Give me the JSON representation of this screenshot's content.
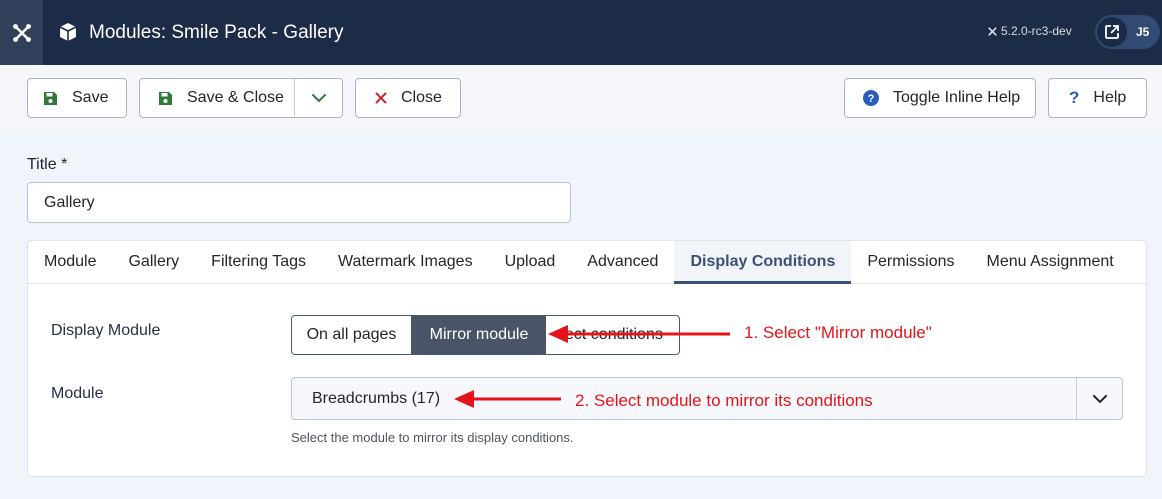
{
  "header": {
    "title": "Modules: Smile Pack - Gallery",
    "version": "5.2.0-rc3-dev",
    "user_badge": "J5"
  },
  "toolbar": {
    "save_label": "Save",
    "save_close_label": "Save & Close",
    "close_label": "Close",
    "toggle_help_label": "Toggle Inline Help",
    "help_label": "Help"
  },
  "form": {
    "title_label": "Title *",
    "title_value": "Gallery"
  },
  "tabs": [
    {
      "label": "Module"
    },
    {
      "label": "Gallery"
    },
    {
      "label": "Filtering Tags"
    },
    {
      "label": "Watermark Images"
    },
    {
      "label": "Upload"
    },
    {
      "label": "Advanced"
    },
    {
      "label": "Display Conditions",
      "active": true
    },
    {
      "label": "Permissions"
    },
    {
      "label": "Menu Assignment"
    }
  ],
  "display_conditions": {
    "display_module_label": "Display Module",
    "options": [
      "On all pages",
      "Mirror module",
      "ect conditions"
    ],
    "selected_option": "Mirror module",
    "module_label": "Module",
    "module_value": "Breadcrumbs (17)",
    "module_hint": "Select the module to mirror its display conditions."
  },
  "annotations": {
    "step1": "1. Select \"Mirror module\"",
    "step2": "2. Select module to mirror its conditions"
  },
  "colors": {
    "header_bg": "#1d2c46",
    "active_tab": "#3a5078",
    "selected_option_bg": "#495566",
    "annotation_red": "#e4141a",
    "save_icon_green": "#2f7a3a",
    "close_icon_red": "#c52827",
    "help_icon_blue": "#2a5dbe"
  }
}
